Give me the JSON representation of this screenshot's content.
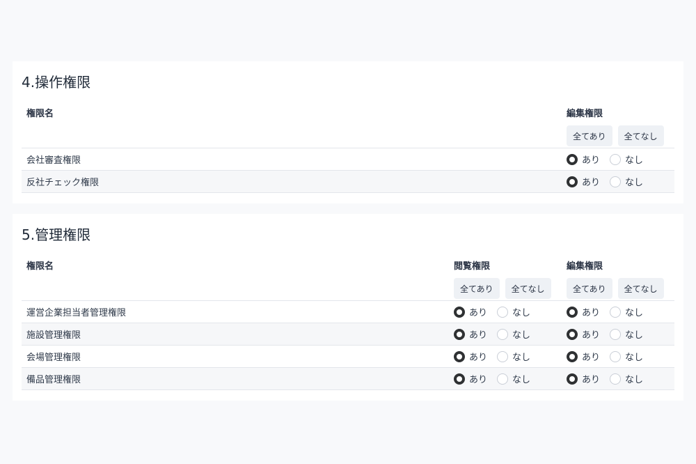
{
  "section4": {
    "title": "4.操作権限",
    "col_name": "権限名",
    "groups": [
      {
        "label": "編集権限",
        "all_on": "全てあり",
        "all_off": "全てなし"
      }
    ],
    "rows": [
      {
        "name": "会社審査権限",
        "values": [
          "あり"
        ]
      },
      {
        "name": "反社チェック権限",
        "values": [
          "あり"
        ]
      }
    ]
  },
  "section5": {
    "title": "5.管理権限",
    "col_name": "権限名",
    "groups": [
      {
        "label": "閲覧権限",
        "all_on": "全てあり",
        "all_off": "全てなし"
      },
      {
        "label": "編集権限",
        "all_on": "全てあり",
        "all_off": "全てなし"
      }
    ],
    "rows": [
      {
        "name": "運営企業担当者管理権限",
        "values": [
          "あり",
          "あり"
        ]
      },
      {
        "name": "施設管理権限",
        "values": [
          "あり",
          "あり"
        ]
      },
      {
        "name": "会場管理権限",
        "values": [
          "あり",
          "あり"
        ]
      },
      {
        "name": "備品管理権限",
        "values": [
          "あり",
          "あり"
        ]
      }
    ]
  },
  "options": {
    "yes": "あり",
    "no": "なし"
  },
  "colors": {
    "radio_selected": "#2f3133",
    "radio_unselected": "#c9ced6",
    "button_bg": "#eef1f5",
    "row_alt": "#f6f7f9"
  }
}
